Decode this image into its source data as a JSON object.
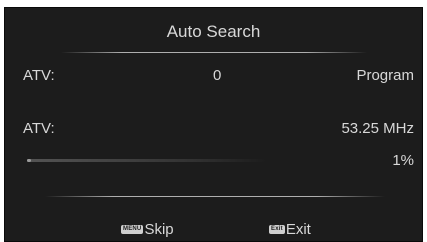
{
  "dialog": {
    "title": "Auto Search"
  },
  "atv_count_row": {
    "label": "ATV:",
    "count": "0",
    "status": "Program"
  },
  "atv_freq_row": {
    "label": "ATV:",
    "frequency": "53.25 MHz"
  },
  "progress": {
    "percent_text": "1%",
    "fraction": 0.01
  },
  "footer": {
    "skip_key": "MENU",
    "skip_label": "Skip",
    "exit_key": "Exit",
    "exit_label": "Exit"
  }
}
